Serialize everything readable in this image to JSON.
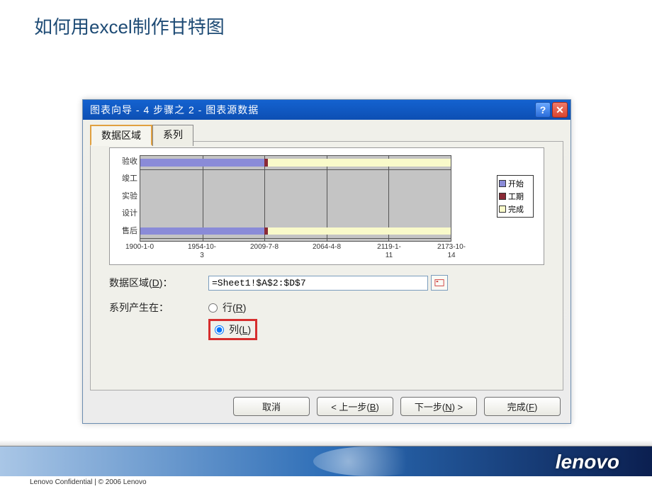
{
  "slide": {
    "title": "如何用excel制作甘特图"
  },
  "dialog": {
    "title": "图表向导 - 4 步骤之 2 - 图表源数据",
    "tabs": {
      "data_range": "数据区域",
      "series": "系列"
    },
    "labels": {
      "data_range": "数据区域(D)：",
      "series_in": "系列产生在：",
      "row": "行(R)",
      "col": "列(L)"
    },
    "input": {
      "range_value": "=Sheet1!$A$2:$D$7"
    },
    "buttons": {
      "cancel": "取消",
      "back": "< 上一步(B)",
      "next": "下一步(N) >",
      "finish": "完成(F)"
    }
  },
  "chart_data": {
    "type": "bar",
    "orientation": "horizontal",
    "categories": [
      "验收",
      "竣工",
      "实验",
      "设计",
      "售后"
    ],
    "series": [
      {
        "name": "开始",
        "color": "#8a8bd8"
      },
      {
        "name": "工期",
        "color": "#8a2a36"
      },
      {
        "name": "完成",
        "color": "#f9faca"
      }
    ],
    "x_ticks": [
      "1900-1-0",
      "1954-10-",
      "2009-7-8",
      "2064-4-8",
      "2119-1-",
      "2173-10-"
    ],
    "x_sub": [
      "3",
      "11",
      "14"
    ],
    "legend": [
      "开始",
      "工期",
      "完成"
    ]
  },
  "footer": {
    "logo_text": "lenovo",
    "confidential": "Lenovo Confidential | © 2006 Lenovo"
  }
}
